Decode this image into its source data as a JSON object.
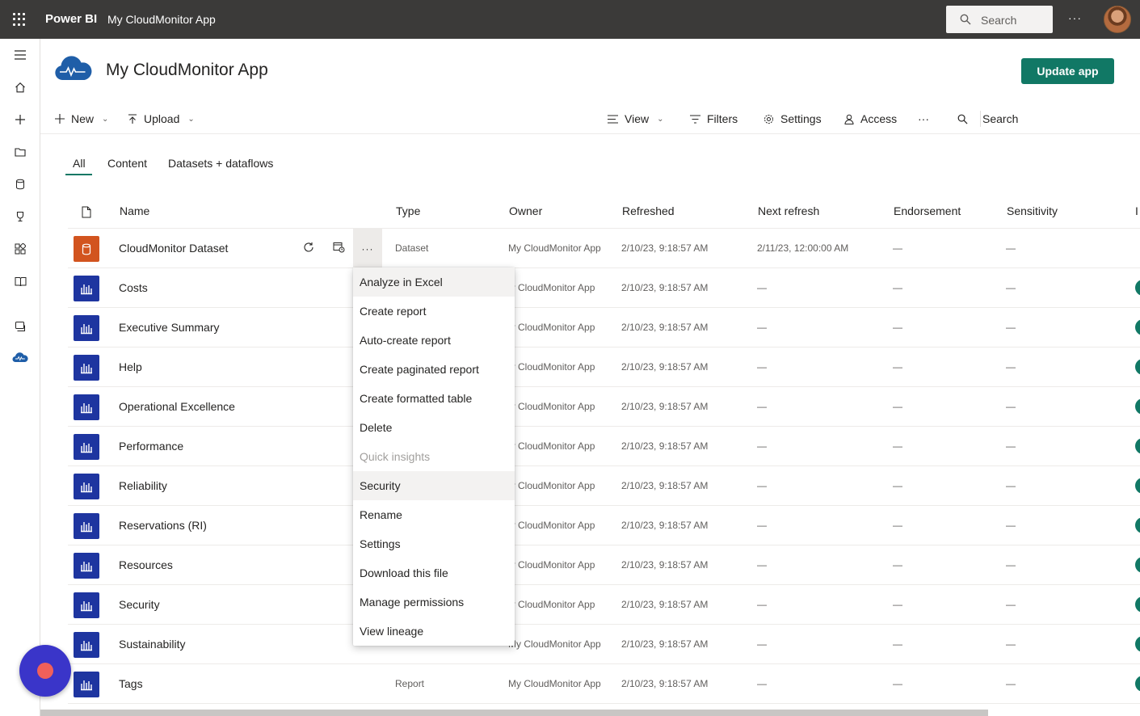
{
  "topbar": {
    "brand": "Power BI",
    "app_name": "My CloudMonitor App",
    "search_placeholder": "Search",
    "more": "···"
  },
  "header": {
    "title": "My CloudMonitor App",
    "update_button": "Update app"
  },
  "toolbar": {
    "new": "New",
    "upload": "Upload",
    "view": "View",
    "filters": "Filters",
    "settings": "Settings",
    "access": "Access",
    "more": "···",
    "search": "Search"
  },
  "tabs": [
    "All",
    "Content",
    "Datasets + dataflows"
  ],
  "table": {
    "columns": [
      "Name",
      "Type",
      "Owner",
      "Refreshed",
      "Next refresh",
      "Endorsement",
      "Sensitivity",
      "I"
    ],
    "rows": [
      {
        "name": "CloudMonitor Dataset",
        "type": "Dataset",
        "owner": "My CloudMonitor App",
        "refreshed": "2/10/23, 9:18:57 AM",
        "next": "2/11/23, 12:00:00 AM",
        "endorsement": "—",
        "sensitivity": "—",
        "kind": "dataset"
      },
      {
        "name": "Costs",
        "type": "",
        "owner": "ly CloudMonitor App",
        "refreshed": "2/10/23, 9:18:57 AM",
        "next": "—",
        "endorsement": "—",
        "sensitivity": "—",
        "kind": "report"
      },
      {
        "name": "Executive Summary",
        "type": "",
        "owner": "ly CloudMonitor App",
        "refreshed": "2/10/23, 9:18:57 AM",
        "next": "—",
        "endorsement": "—",
        "sensitivity": "—",
        "kind": "report"
      },
      {
        "name": "Help",
        "type": "",
        "owner": "ly CloudMonitor App",
        "refreshed": "2/10/23, 9:18:57 AM",
        "next": "—",
        "endorsement": "—",
        "sensitivity": "—",
        "kind": "report"
      },
      {
        "name": "Operational Excellence",
        "type": "",
        "owner": "ly CloudMonitor App",
        "refreshed": "2/10/23, 9:18:57 AM",
        "next": "—",
        "endorsement": "—",
        "sensitivity": "—",
        "kind": "report"
      },
      {
        "name": "Performance",
        "type": "",
        "owner": "ly CloudMonitor App",
        "refreshed": "2/10/23, 9:18:57 AM",
        "next": "—",
        "endorsement": "—",
        "sensitivity": "—",
        "kind": "report"
      },
      {
        "name": "Reliability",
        "type": "",
        "owner": "ly CloudMonitor App",
        "refreshed": "2/10/23, 9:18:57 AM",
        "next": "—",
        "endorsement": "—",
        "sensitivity": "—",
        "kind": "report"
      },
      {
        "name": "Reservations (RI)",
        "type": "",
        "owner": "ly CloudMonitor App",
        "refreshed": "2/10/23, 9:18:57 AM",
        "next": "—",
        "endorsement": "—",
        "sensitivity": "—",
        "kind": "report"
      },
      {
        "name": "Resources",
        "type": "",
        "owner": "ly CloudMonitor App",
        "refreshed": "2/10/23, 9:18:57 AM",
        "next": "—",
        "endorsement": "—",
        "sensitivity": "—",
        "kind": "report"
      },
      {
        "name": "Security",
        "type": "",
        "owner": "ly CloudMonitor App",
        "refreshed": "2/10/23, 9:18:57 AM",
        "next": "—",
        "endorsement": "—",
        "sensitivity": "—",
        "kind": "report"
      },
      {
        "name": "Sustainability",
        "type": "",
        "owner": "My CloudMonitor App",
        "refreshed": "2/10/23, 9:18:57 AM",
        "next": "—",
        "endorsement": "—",
        "sensitivity": "—",
        "kind": "report"
      },
      {
        "name": "Tags",
        "type": "Report",
        "owner": "My CloudMonitor App",
        "refreshed": "2/10/23, 9:18:57 AM",
        "next": "—",
        "endorsement": "—",
        "sensitivity": "—",
        "kind": "report"
      }
    ]
  },
  "row_more": "···",
  "context_menu": {
    "items": [
      "Analyze in Excel",
      "Create report",
      "Auto-create report",
      "Create paginated report",
      "Create formatted table",
      "Delete",
      "Quick insights",
      "Security",
      "Rename",
      "Settings",
      "Download this file",
      "Manage permissions",
      "View lineage"
    ],
    "disabled_item": "Quick insights",
    "highlighted_items": [
      "Analyze in Excel",
      "Security"
    ]
  },
  "colors": {
    "topbar": "#3b3a39",
    "accent": "#117865",
    "report_icon": "#1e35a0",
    "dataset_icon": "#d2541f",
    "fab": "#3a35c9"
  },
  "icons": {
    "rail": [
      "hamburger-icon",
      "home-icon",
      "create-icon",
      "browse-icon",
      "datahub-icon",
      "goals-icon",
      "apps-icon",
      "learn-icon",
      "workspaces-icon",
      "cloudmonitor-app-icon"
    ],
    "toolbar": [
      "plus-icon",
      "upload-icon",
      "view-icon",
      "filter-icon",
      "settings-icon",
      "access-icon",
      "search-icon"
    ]
  }
}
